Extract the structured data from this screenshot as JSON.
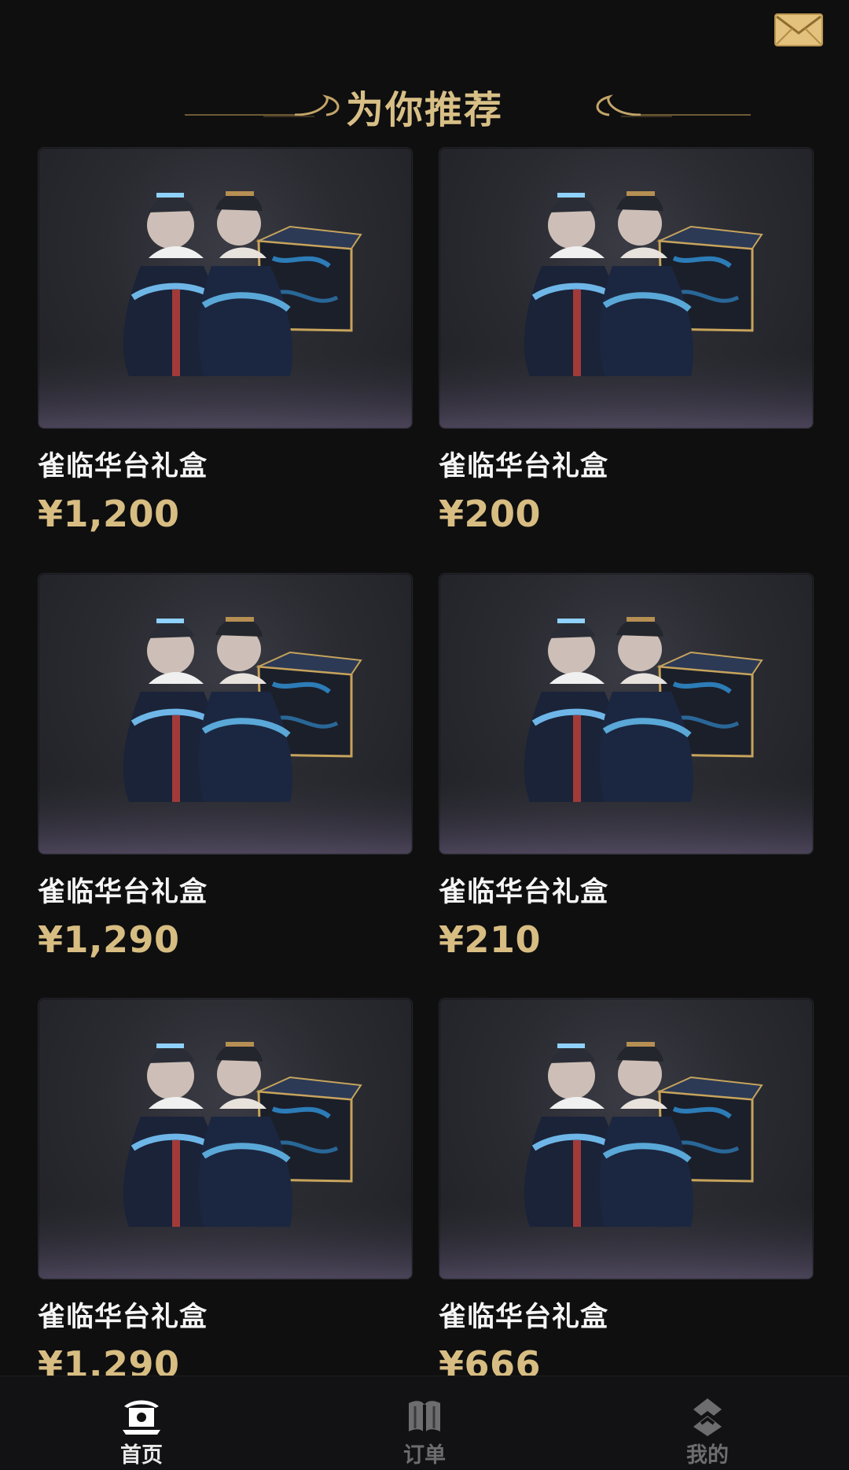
{
  "header": {
    "mail_icon": "mail-envelope-icon",
    "section_title": "为你推荐"
  },
  "products": [
    {
      "title": "雀临华台礼盒",
      "price": "¥1,200",
      "image_icon": "gift-box-character-illustration"
    },
    {
      "title": "雀临华台礼盒",
      "price": "¥200",
      "image_icon": "gift-box-character-illustration"
    },
    {
      "title": "雀临华台礼盒",
      "price": "¥1,290",
      "image_icon": "gift-box-character-illustration"
    },
    {
      "title": "雀临华台礼盒",
      "price": "¥210",
      "image_icon": "gift-box-character-illustration"
    },
    {
      "title": "雀临华台礼盒",
      "price": "¥1,290",
      "image_icon": "gift-box-character-illustration"
    },
    {
      "title": "雀临华台礼盒",
      "price": "¥666",
      "image_icon": "gift-box-character-illustration"
    }
  ],
  "bottom_nav": {
    "items": [
      {
        "label": "首页",
        "icon": "home-pavilion-icon",
        "active": true
      },
      {
        "label": "订单",
        "icon": "orders-book-icon",
        "active": false
      },
      {
        "label": "我的",
        "icon": "profile-emblem-icon",
        "active": false
      }
    ]
  },
  "colors": {
    "background": "#0f0f10",
    "gold": "#d8bd82",
    "title_gold": "#d7bf86",
    "text_white": "#f5f5f5",
    "inactive_gray": "#6d6d70"
  }
}
